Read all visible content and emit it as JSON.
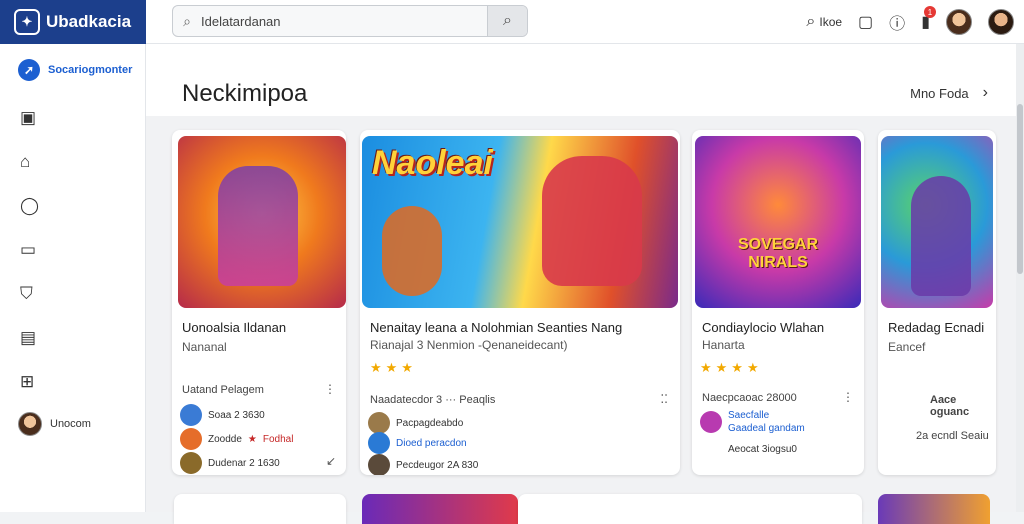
{
  "app": {
    "name": "Ubadkacia"
  },
  "search": {
    "value": "Idelatardanan"
  },
  "toolbar": {
    "label": "Ikoe",
    "notif_count": "1"
  },
  "sidebar": {
    "top_label": "Socariogmonter",
    "user_label": "Unocom"
  },
  "section": {
    "title": "Neckimipoa",
    "more_label": "Mno Foda"
  },
  "cards": [
    {
      "name": "Uonoalsia Ildanan",
      "sub": "Nananal",
      "meta": "Uatand Pelagem",
      "r1": "Soaa 2 3630",
      "r2a": "Zoodde",
      "r2b": "Fodhal",
      "r3": "Dudenar 2 1630"
    },
    {
      "name": "Nenaitay leana a Nolohmian Seanties Nang",
      "sub": "Rianajal  3 Nenmion  -Qenaneidecant)",
      "stars": "★★★",
      "meta": "Naadatecdor 3   ···  Peaqlis",
      "r1": "Pacpagdeabdo",
      "r2": "Dioed peracdon",
      "r3": "Pecdeugor 2A 830",
      "banner": "Naoleai"
    },
    {
      "name": "Condiaylocio Wlahan",
      "sub": "Hanarta",
      "stars": "★★★★",
      "meta": "Naecpcaoac 28000",
      "r1": "Saecfalle",
      "r2": "Gaadeal gandam",
      "r3": "Aeocat 3iogsu0",
      "banner": "SOVEGAR NIRALS"
    },
    {
      "name": "Redadag Ecnadi",
      "sub": "Eancef",
      "meta": "Aace oguanc",
      "r1": "2a ecndl Seaiu"
    }
  ]
}
